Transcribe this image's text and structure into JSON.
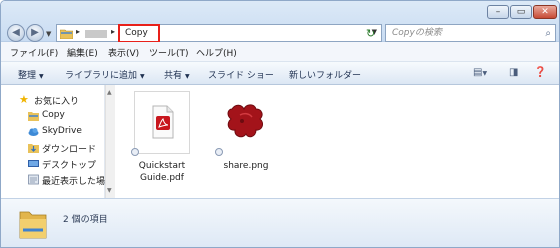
{
  "window": {
    "address": {
      "current_folder": "Copy",
      "refresh_glyph": "↻",
      "back_glyph": "◀",
      "forward_glyph": "▶"
    },
    "search": {
      "placeholder": "Copyの検索",
      "icon": "search-icon"
    },
    "controls": {
      "minimize": "–",
      "maximize": "▭",
      "close": "✕"
    }
  },
  "menubar": {
    "items": [
      {
        "label": "ファイル(F)"
      },
      {
        "label": "編集(E)"
      },
      {
        "label": "表示(V)"
      },
      {
        "label": "ツール(T)"
      },
      {
        "label": "ヘルプ(H)"
      }
    ]
  },
  "toolbar": {
    "organize": "整理",
    "add_to_library": "ライブラリに追加",
    "share": "共有",
    "slideshow": "スライド ショー",
    "new_folder": "新しいフォルダー"
  },
  "navpane": {
    "favorites": "お気に入り",
    "items": [
      {
        "label": "Copy",
        "icon": "copy-folder-icon"
      },
      {
        "label": "SkyDrive",
        "icon": "skydrive-icon"
      },
      {
        "label": "ダウンロード",
        "icon": "download-folder-icon"
      },
      {
        "label": "デスクトップ",
        "icon": "desktop-icon"
      },
      {
        "label": "最近表示した場所",
        "icon": "recent-places-icon"
      }
    ]
  },
  "files": [
    {
      "name_line1": "Quickstart",
      "name_line2": "Guide.pdf",
      "icon": "pdf-file-icon"
    },
    {
      "name_line1": "share.png",
      "name_line2": "",
      "icon": "png-file-icon"
    }
  ],
  "details": {
    "item_count": "2 個の項目"
  },
  "colors": {
    "highlight_border": "#e8201a",
    "pdf_red": "#c8161d",
    "puzzle_red": "#a3131a"
  }
}
